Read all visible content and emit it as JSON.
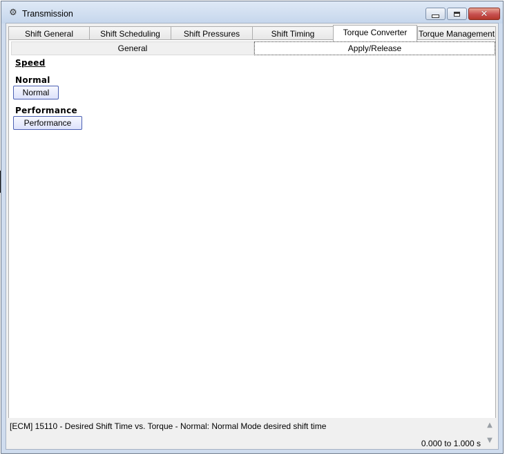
{
  "window": {
    "title": "Transmission",
    "icon": "gear-icon"
  },
  "tabs": [
    {
      "label": "Shift General",
      "active": false
    },
    {
      "label": "Shift Scheduling",
      "active": false
    },
    {
      "label": "Shift Pressures",
      "active": false
    },
    {
      "label": "Shift Timing",
      "active": false
    },
    {
      "label": "Torque Converter",
      "active": true
    },
    {
      "label": "Torque Management",
      "active": false
    }
  ],
  "subtabs": [
    {
      "label": "General",
      "active": false
    },
    {
      "label": "Apply/Release",
      "active": true
    }
  ],
  "content": {
    "section_title": "Speed",
    "groups": [
      {
        "label": "Normal",
        "button": "Normal"
      },
      {
        "label": "Performance",
        "button": "Performance"
      }
    ]
  },
  "status": {
    "description": "[ECM] 15110 - Desired Shift Time vs. Torque - Normal: Normal Mode desired shift time",
    "range_from": "0.000",
    "range_sep": "to",
    "range_to": "1.000 s"
  }
}
